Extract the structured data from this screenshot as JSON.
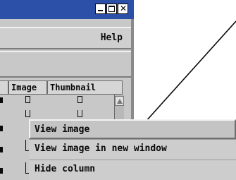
{
  "window": {
    "controls": {
      "minimize": "minimize-icon",
      "maximize": "maximize-icon",
      "close": "close-icon"
    }
  },
  "menubar": {
    "help_label": "Help"
  },
  "table": {
    "columns": [
      "Image",
      "Thumbnail"
    ]
  },
  "context_menu": {
    "items": [
      "View image",
      "View image in new window",
      "Hide column"
    ]
  }
}
